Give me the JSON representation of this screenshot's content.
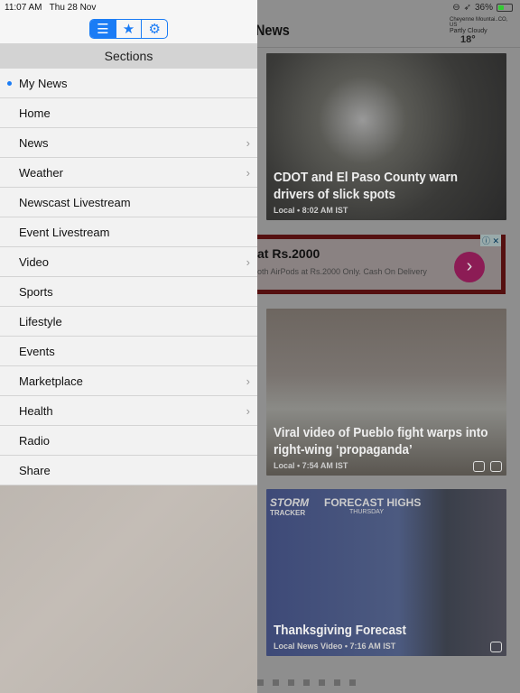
{
  "status": {
    "time": "11:07 AM",
    "date": "Thu 28 Nov",
    "battery": "36%",
    "battery_level": 0.36
  },
  "header": {
    "title": "News",
    "weather": {
      "location": "Cheyenne Mountai..CO, US",
      "condition": "Partly Cloudy",
      "temp": "18°"
    }
  },
  "toolbar": {
    "segments": [
      {
        "icon": "list-icon",
        "selected": true
      },
      {
        "icon": "star-icon"
      },
      {
        "icon": "gear-icon"
      }
    ]
  },
  "sidebar": {
    "title": "Sections",
    "items": [
      {
        "label": "My News",
        "active": true
      },
      {
        "label": "Home"
      },
      {
        "label": "News",
        "chevron": true
      },
      {
        "label": "Weather",
        "chevron": true
      },
      {
        "label": "Newscast Livestream"
      },
      {
        "label": "Event Livestream"
      },
      {
        "label": "Video",
        "chevron": true
      },
      {
        "label": "Sports"
      },
      {
        "label": "Lifestyle"
      },
      {
        "label": "Events"
      },
      {
        "label": "Marketplace",
        "chevron": true
      },
      {
        "label": "Health",
        "chevron": true
      },
      {
        "label": "Radio"
      },
      {
        "label": "Share"
      }
    ]
  },
  "articles": [
    {
      "title_1": "CDOT and El Paso County warn",
      "title_2": "drivers of slick spots",
      "meta": "Local • 8:02 AM IST"
    },
    {
      "title_1": "Viral video of Pueblo fight warps into",
      "title_2": "right-wing ‘propaganda’",
      "meta": "Local • 7:54 AM IST"
    },
    {
      "title_1": "Thanksgiving Forecast",
      "title_2": "",
      "meta": "Local News Video • 7:16 AM IST",
      "overlay_1": "STORM",
      "overlay_2": "FORECAST HIGHS",
      "overlay_3": "TRACKER",
      "overlay_4": "THURSDAY"
    }
  ],
  "ad": {
    "title": "at Rs.2000",
    "subtitle": "oth AirPods at Rs.2000 Only. Cash On Delivery"
  }
}
